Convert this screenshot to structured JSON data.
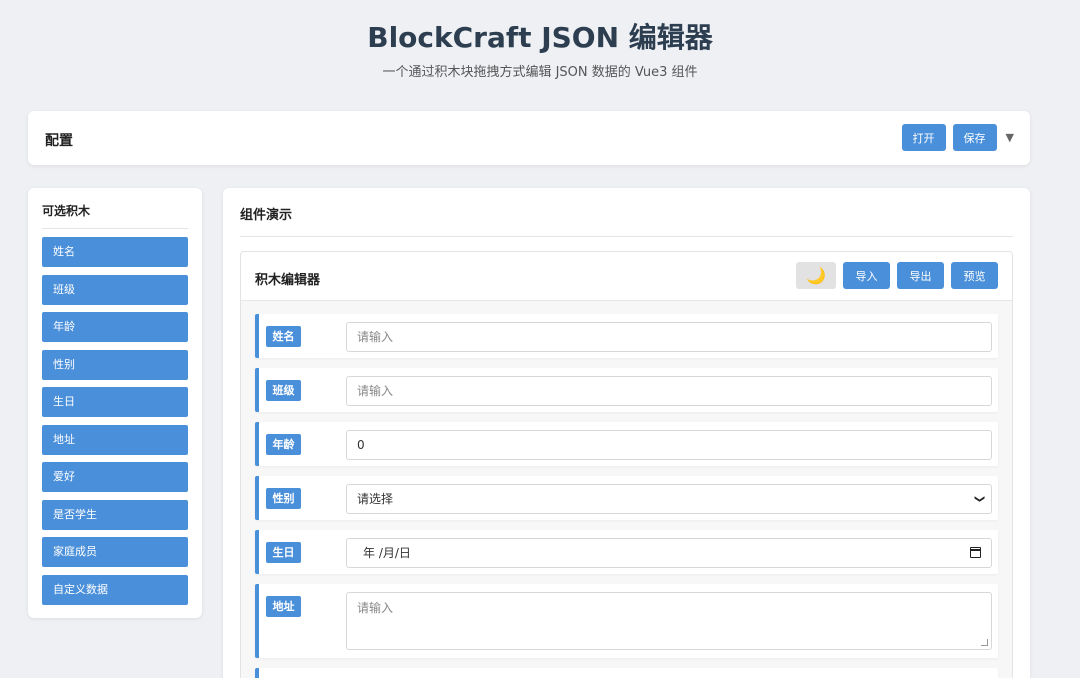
{
  "header": {
    "title": "BlockCraft JSON 编辑器",
    "subtitle": "一个通过积木块拖拽方式编辑 JSON 数据的 Vue3 组件"
  },
  "config": {
    "title": "配置",
    "open_label": "打开",
    "save_label": "保存",
    "caret_glyph": "▼"
  },
  "palette": {
    "title": "可选积木",
    "items": [
      "姓名",
      "班级",
      "年龄",
      "性别",
      "生日",
      "地址",
      "爱好",
      "是否学生",
      "家庭成员",
      "自定义数据"
    ]
  },
  "demo": {
    "title": "组件演示"
  },
  "editor": {
    "title": "积木编辑器",
    "theme_icon": "moon-icon",
    "theme_glyph": "🌙",
    "import_label": "导入",
    "export_label": "导出",
    "preview_label": "预览",
    "blocks": [
      {
        "label": "姓名",
        "type": "text",
        "placeholder": "请输入",
        "value": ""
      },
      {
        "label": "班级",
        "type": "text",
        "placeholder": "请输入",
        "value": ""
      },
      {
        "label": "年龄",
        "type": "number",
        "placeholder": "",
        "value": "0"
      },
      {
        "label": "性别",
        "type": "select",
        "placeholder": "",
        "value": "请选择"
      },
      {
        "label": "生日",
        "type": "date",
        "placeholder": "",
        "value": "年 /月/日"
      },
      {
        "label": "地址",
        "type": "textarea",
        "placeholder": "请输入",
        "value": ""
      }
    ]
  },
  "colors": {
    "accent": "#4a8fd9",
    "background": "#eef0f4",
    "card": "#ffffff"
  }
}
